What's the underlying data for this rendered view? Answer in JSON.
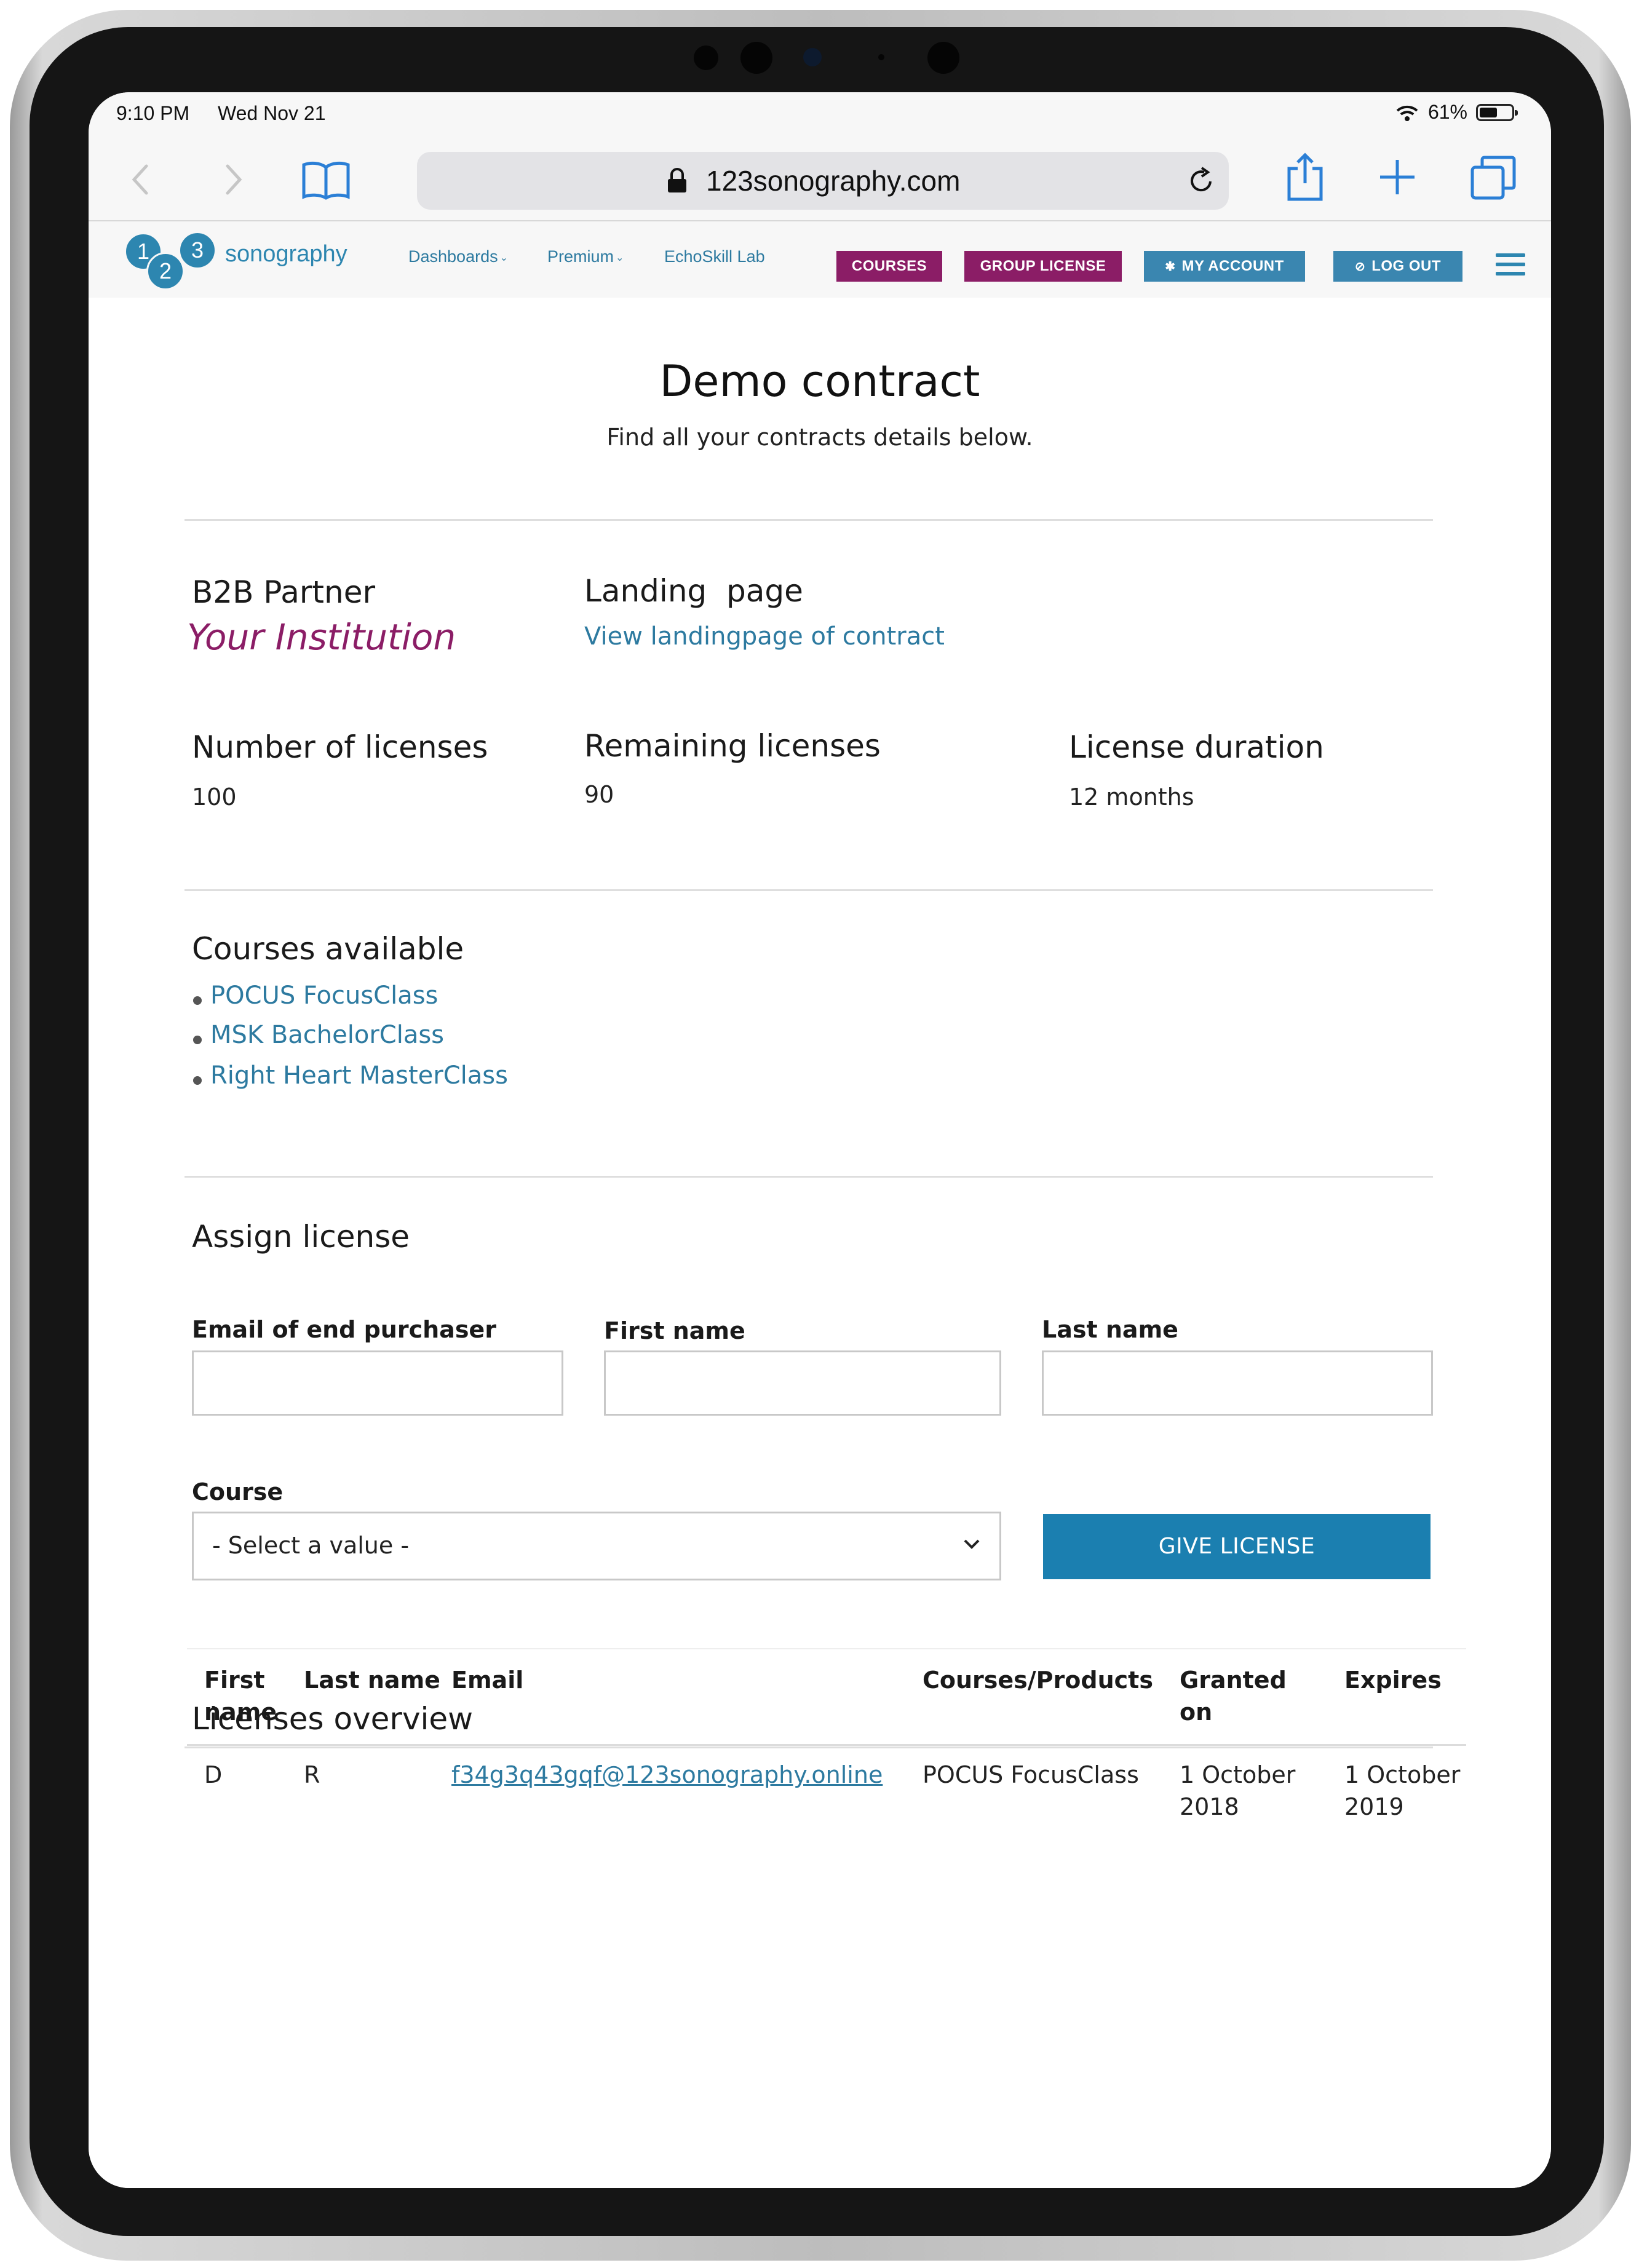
{
  "status_bar": {
    "time": "9:10 PM",
    "date": "Wed Nov 21",
    "battery": "61%",
    "battery_level": 0.61
  },
  "browser": {
    "url": "123sonography.com"
  },
  "site_nav": {
    "logo_digits": [
      "1",
      "2",
      "3"
    ],
    "logo_text": "sonography",
    "links": [
      "Dashboards",
      "Premium",
      "EchoSkill Lab"
    ],
    "buttons": {
      "courses": "COURSES",
      "group_license": "GROUP LICENSE",
      "my_account": "MY ACCOUNT",
      "log_out": "LOG OUT"
    }
  },
  "page": {
    "title": "Demo contract",
    "subtitle": "Find all your contracts details below."
  },
  "contract": {
    "partner_label": "B2B Partner",
    "partner_value": "Your Institution",
    "landing_label": "Landing  page",
    "landing_link": "View landingpage of contract",
    "licenses_label": "Number of licenses",
    "licenses_value": "100",
    "remaining_label": "Remaining licenses",
    "remaining_value": "90",
    "duration_label": "License duration",
    "duration_value": "12 months"
  },
  "courses": {
    "title": "Courses available",
    "items": [
      "POCUS FocusClass",
      "MSK BachelorClass",
      "Right Heart MasterClass"
    ]
  },
  "assign": {
    "title": "Assign license",
    "email_label": "Email of end purchaser",
    "first_name_label": "First name",
    "last_name_label": "Last name",
    "course_label": "Course",
    "course_placeholder": "- Select a value -",
    "button": "GIVE LICENSE"
  },
  "overview": {
    "title": "Licenses overview",
    "headers": {
      "first_name": [
        "First",
        "name"
      ],
      "last_name": "Last name",
      "email": "Email",
      "courses": "Courses/Products",
      "granted": [
        "Granted",
        "on"
      ],
      "expires": "Expires"
    },
    "rows": [
      {
        "first_name": "D",
        "last_name": "R",
        "email": "f34g3q43gqf@123sonography.online",
        "course": "POCUS FocusClass",
        "granted": [
          "1 October",
          "2018"
        ],
        "expires": [
          "1 October",
          "2019"
        ]
      }
    ]
  },
  "colors": {
    "brand_blue": "#2d86b0",
    "brand_purple": "#8b1d66",
    "link": "#2d7aa0",
    "button_blue": "#1b7fb0",
    "safari_blue": "#2b7fd6"
  },
  "icons": [
    "back-icon",
    "forward-icon",
    "bookmarks-icon",
    "lock-icon",
    "reload-icon",
    "share-icon",
    "new-tab-icon",
    "tabs-icon",
    "wifi-icon",
    "battery-icon",
    "gear-icon",
    "logout-icon",
    "hamburger-icon",
    "chevron-down-icon"
  ]
}
